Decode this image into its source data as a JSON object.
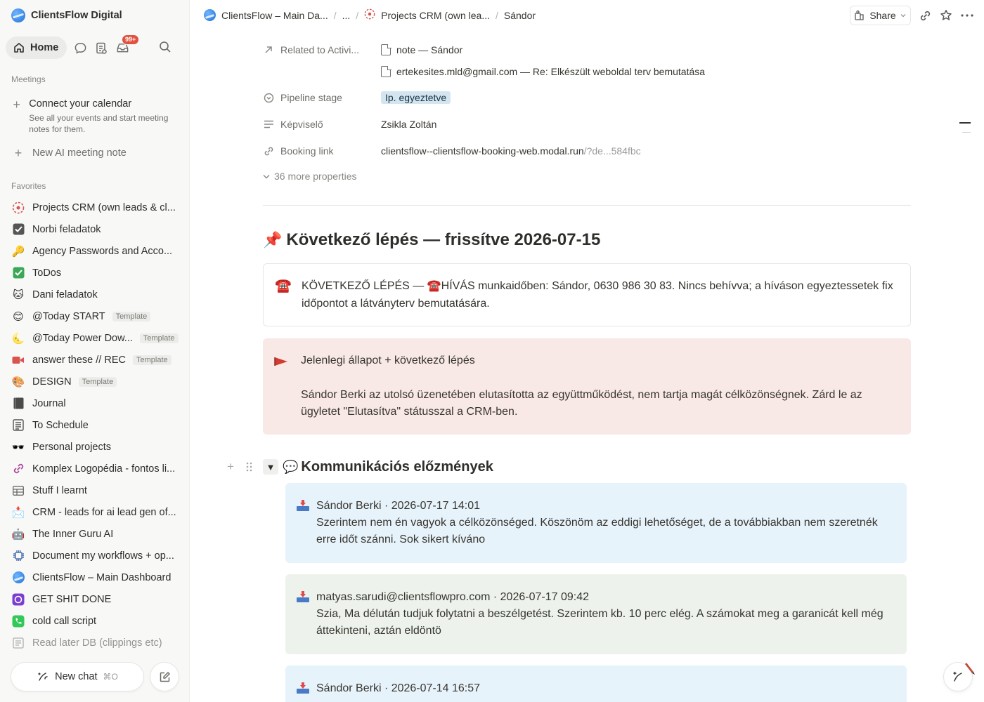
{
  "sidebar": {
    "workspace": "ClientsFlow Digital",
    "nav": {
      "home": "Home",
      "inbox_badge": "99+"
    },
    "meetings_label": "Meetings",
    "connect_calendar": {
      "title": "Connect your calendar",
      "desc": "See all your events and start meeting notes for them."
    },
    "new_ai_note": "New AI meeting note",
    "favorites_label": "Favorites",
    "favorites": [
      {
        "icon": "crm-target-icon",
        "label": "Projects CRM (own leads & cl...",
        "template": ""
      },
      {
        "icon": "checkbox-icon",
        "label": "Norbi feladatok",
        "template": ""
      },
      {
        "icon": "key-icon",
        "label": "Agency Passwords and Acco...",
        "template": ""
      },
      {
        "icon": "check-mark-icon",
        "label": "ToDos",
        "template": ""
      },
      {
        "icon": "cat-icon",
        "label": "Dani feladatok",
        "template": ""
      },
      {
        "icon": "smile-icon",
        "label": "@Today START",
        "template": "Template"
      },
      {
        "icon": "moon-icon",
        "label": "@Today Power Dow...",
        "template": "Template"
      },
      {
        "icon": "video-camera-icon",
        "label": "answer these // REC",
        "template": "Template"
      },
      {
        "icon": "palette-icon",
        "label": "DESIGN",
        "template": "Template"
      },
      {
        "icon": "notebook-icon",
        "label": "Journal",
        "template": ""
      },
      {
        "icon": "calendar-list-icon",
        "label": "To Schedule",
        "template": ""
      },
      {
        "icon": "sunglasses-icon",
        "label": "Personal projects",
        "template": ""
      },
      {
        "icon": "link-icon",
        "label": "Komplex Logopédia - fontos li...",
        "template": ""
      },
      {
        "icon": "table-icon",
        "label": "Stuff I learnt",
        "template": ""
      },
      {
        "icon": "inbox-tray-icon",
        "label": "CRM - leads for ai lead gen of...",
        "template": ""
      },
      {
        "icon": "robot-icon",
        "label": "The Inner Guru AI",
        "template": ""
      },
      {
        "icon": "chip-icon",
        "label": "Document my workflows + op...",
        "template": ""
      },
      {
        "icon": "globe-icon",
        "label": "ClientsFlow – Main Dashboard",
        "template": ""
      },
      {
        "icon": "focus-icon",
        "label": "GET SHIT DONE",
        "template": ""
      },
      {
        "icon": "phone-icon",
        "label": "cold call script",
        "template": ""
      },
      {
        "icon": "newspaper-icon",
        "label": "Read later DB (clippings etc)",
        "template": ""
      }
    ],
    "new_chat": "New chat",
    "new_chat_shortcut": "⌘O"
  },
  "topbar": {
    "breadcrumbs": [
      "ClientsFlow – Main Da...",
      "...",
      "Projects CRM (own lea...",
      "Sándor"
    ],
    "share": "Share"
  },
  "properties": {
    "related": {
      "name": "Related to Activi...",
      "values": [
        "note — Sándor",
        "ertekesites.mld@gmail.com — Re: Elkészült weboldal terv bemutatása"
      ]
    },
    "pipeline": {
      "name": "Pipeline stage",
      "value": "Ip. egyeztetve"
    },
    "rep": {
      "name": "Képviselő",
      "value": "Zsikla Zoltán"
    },
    "booking": {
      "name": "Booking link",
      "value": "clientsflow--clientsflow-booking-web.modal.run",
      "value_faded": "/?de...584fbc"
    },
    "more": "36 more properties"
  },
  "content": {
    "next_step_heading": "Következő lépés — frissítve 2026-07-15",
    "next_step_callout": "KÖVETKEZŐ LÉPÉS — ☎️HÍVÁS munkaidőben: Sándor, 0630 986 30 83. Nincs behívva; a híváson egyeztessetek fix időpontot a látványterv bemutatására.",
    "status_title": "Jelenlegi állapot + következő lépés",
    "status_body": "Sándor Berki az utolsó üzenetében elutasította az együttműködést, nem tartja magát célközönségnek. Zárd le az ügyletet \"Elutasítva\" státusszal a CRM-ben.",
    "history_heading": "Kommunikációs előzmények",
    "messages": [
      {
        "header": "Sándor Berki · 2026-07-17 14:01",
        "body": "Szerintem nem én vagyok a célközönséged. Köszönöm az eddigi lehetőséget, de a továbbiakban nem szeretnék erre időt szánni. Sok sikert kívánо"
      },
      {
        "header": "matyas.sarudi@clientsflowpro.com · 2026-07-17 09:42",
        "body": "Szia, Ma délután tudjuk folytatni a beszélgetést. Szerintem kb. 10 perc elég. A számokat meg a garanicát kell még áttekinteni, aztán eldöntö"
      },
      {
        "header": "Sándor Berki · 2026-07-14 16:57",
        "body": ""
      }
    ]
  },
  "colors": {
    "accent": "#e0523f",
    "tag_blue": "#d3e5ef",
    "callout_red": "#f8e8e6",
    "msg_blue": "#e7f3fb",
    "msg_green": "#edf3ec"
  }
}
